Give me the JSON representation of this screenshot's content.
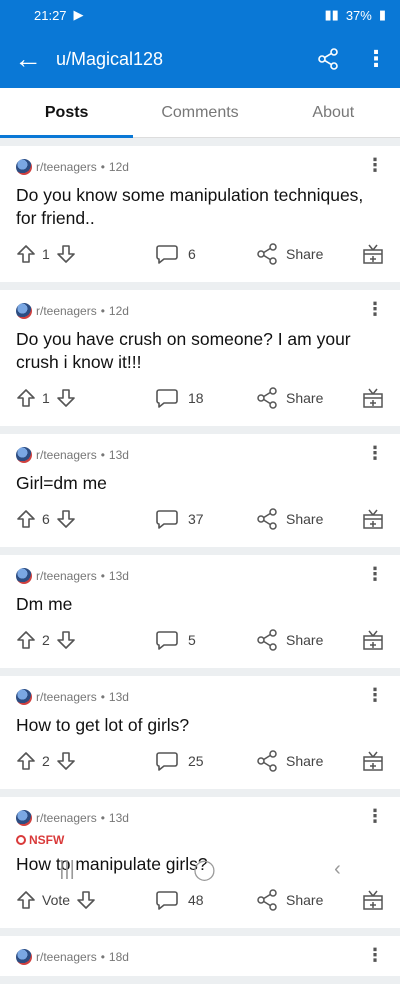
{
  "status": {
    "time": "21:27",
    "battery": "37%"
  },
  "header": {
    "title": "u/Magical128"
  },
  "tabs": [
    "Posts",
    "Comments",
    "About"
  ],
  "share_label": "Share",
  "posts": [
    {
      "community": "r/teenagers",
      "age": "12d",
      "title": "Do you know some manipulation techniques, for friend..",
      "votes": "1",
      "comments": "6"
    },
    {
      "community": "r/teenagers",
      "age": "12d",
      "title": "Do you have crush on someone? I am your crush i know it!!!",
      "votes": "1",
      "comments": "18"
    },
    {
      "community": "r/teenagers",
      "age": "13d",
      "title": "Girl=dm me",
      "votes": "6",
      "comments": "37"
    },
    {
      "community": "r/teenagers",
      "age": "13d",
      "title": "Dm me",
      "votes": "2",
      "comments": "5"
    },
    {
      "community": "r/teenagers",
      "age": "13d",
      "title": "How to get lot of girls?",
      "votes": "2",
      "comments": "25"
    },
    {
      "community": "r/teenagers",
      "age": "13d",
      "nsfw": "NSFW",
      "title": "How to manipulate girls?",
      "votes": "Vote",
      "comments": "48"
    },
    {
      "community": "r/teenagers",
      "age": "18d"
    }
  ]
}
